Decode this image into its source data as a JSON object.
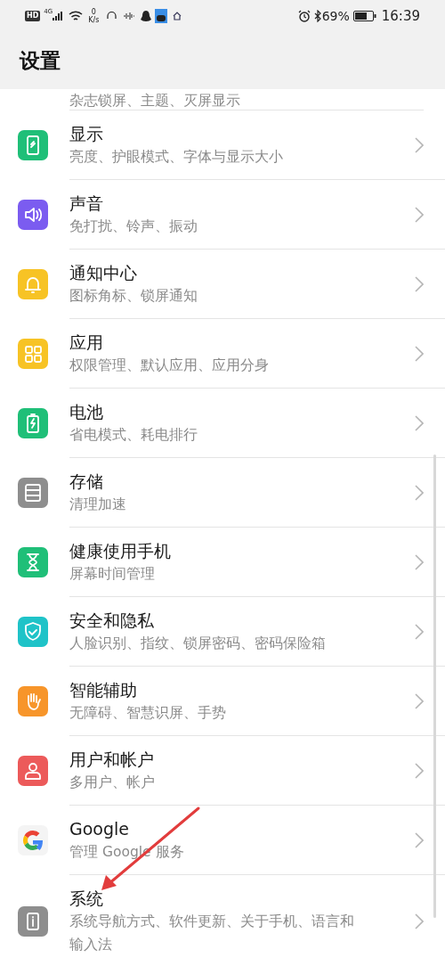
{
  "status_bar": {
    "hd": "HD",
    "network": "4G",
    "speed_value": "0",
    "speed_unit": "K/s",
    "battery_percent": "69%",
    "time": "16:39"
  },
  "header": {
    "title": "设置"
  },
  "cut_row": {
    "subtitle": "杂志锁屏、主题、灭屏显示"
  },
  "items": [
    {
      "title": "显示",
      "subtitle": "亮度、护眼模式、字体与显示大小"
    },
    {
      "title": "声音",
      "subtitle": "免打扰、铃声、振动"
    },
    {
      "title": "通知中心",
      "subtitle": "图标角标、锁屏通知"
    },
    {
      "title": "应用",
      "subtitle": "权限管理、默认应用、应用分身"
    },
    {
      "title": "电池",
      "subtitle": "省电模式、耗电排行"
    },
    {
      "title": "存储",
      "subtitle": "清理加速"
    },
    {
      "title": "健康使用手机",
      "subtitle": "屏幕时间管理"
    },
    {
      "title": "安全和隐私",
      "subtitle": "人脸识别、指纹、锁屏密码、密码保险箱"
    },
    {
      "title": "智能辅助",
      "subtitle": "无障碍、智慧识屏、手势"
    },
    {
      "title": "用户和帐户",
      "subtitle": "多用户、帐户"
    },
    {
      "title": "Google",
      "subtitle": "管理 Google 服务"
    },
    {
      "title": "系统",
      "subtitle": "系统导航方式、软件更新、关于手机、语言和输入法"
    }
  ]
}
